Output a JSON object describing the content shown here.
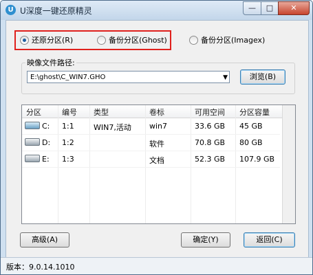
{
  "window": {
    "title": "U深度一键还原精灵",
    "app_icon": "U",
    "minimize_glyph": "—",
    "maximize_glyph": "□",
    "close_glyph": "✕"
  },
  "mode": {
    "options": [
      {
        "label": "还原分区(R)",
        "selected": true
      },
      {
        "label": "备份分区(Ghost)",
        "selected": false
      },
      {
        "label": "备份分区(Imagex)",
        "selected": false
      }
    ]
  },
  "image_path": {
    "label": "映像文件路径:",
    "value": "E:\\ghost\\C_WIN7.GHO",
    "browse_label": "浏览(B)"
  },
  "partitions": {
    "columns": [
      "分区",
      "编号",
      "类型",
      "卷标",
      "可用空间",
      "分区容量"
    ],
    "rows": [
      {
        "drive": "C:",
        "number": "1:1",
        "type": "WIN7,活动",
        "label": "win7",
        "free": "33.6 GB",
        "size": "45 GB",
        "icon": "system-drive-icon"
      },
      {
        "drive": "D:",
        "number": "1:2",
        "type": "",
        "label": "软件",
        "free": "70.8 GB",
        "size": "80 GB",
        "icon": "drive-icon"
      },
      {
        "drive": "E:",
        "number": "1:3",
        "type": "",
        "label": "文档",
        "free": "52.3 GB",
        "size": "107.9 GB",
        "icon": "drive-icon"
      }
    ]
  },
  "buttons": {
    "advanced": "高级(A)",
    "ok": "确定(Y)",
    "back": "返回(C)"
  },
  "status": {
    "version": "版本：9.0.14.1010"
  },
  "colors": {
    "highlight_border": "#e0201c",
    "title_bar": "#c3d6ea"
  }
}
